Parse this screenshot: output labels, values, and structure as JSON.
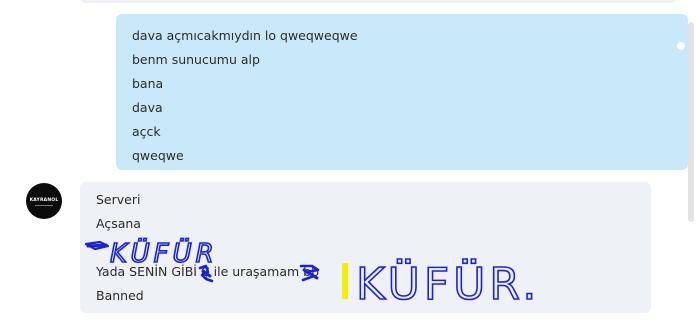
{
  "chat": {
    "outgoing": {
      "lines": [
        "dava açmıcakmıydın lo qweqweqwe",
        "benm sunucumu alp",
        "bana",
        "dava",
        "açck",
        "qweqwe"
      ]
    },
    "incoming": {
      "avatar_logo": "KAYRANOL",
      "lines": [
        "Serveri",
        "Açsana",
        "",
        "Yada SENİN GİBİ Ç  ile uraşamam    bb",
        "Banned"
      ]
    },
    "annotations": {
      "small_word": "KÜFÜR",
      "large_word": "KÜFÜR.",
      "ink_color": "#1a22d6",
      "highlight_color": "#f2ee00"
    }
  }
}
